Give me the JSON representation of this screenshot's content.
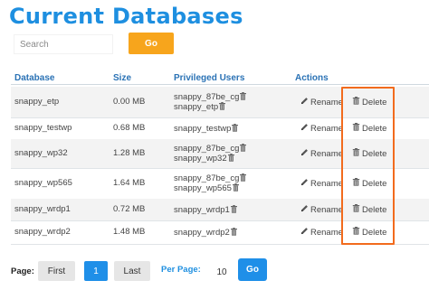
{
  "page": {
    "title": "Current Databases"
  },
  "search": {
    "placeholder": "Search",
    "value": "",
    "go_label": "Go"
  },
  "table": {
    "columns": [
      "Database",
      "Size",
      "Privileged Users",
      "Actions"
    ],
    "rename_label": "Rename",
    "delete_label": "Delete",
    "rows": [
      {
        "name": "snappy_etp",
        "size": "0.00 MB",
        "users": [
          "snappy_87be_cg",
          "snappy_etp"
        ]
      },
      {
        "name": "snappy_testwp",
        "size": "0.68 MB",
        "users": [
          "snappy_testwp"
        ]
      },
      {
        "name": "snappy_wp32",
        "size": "1.28 MB",
        "users": [
          "snappy_87be_cg",
          "snappy_wp32"
        ]
      },
      {
        "name": "snappy_wp565",
        "size": "1.64 MB",
        "users": [
          "snappy_87be_cg",
          "snappy_wp565"
        ]
      },
      {
        "name": "snappy_wrdp1",
        "size": "0.72 MB",
        "users": [
          "snappy_wrdp1"
        ]
      },
      {
        "name": "snappy_wrdp2",
        "size": "1.48 MB",
        "users": [
          "snappy_wrdp2"
        ]
      }
    ]
  },
  "pagination": {
    "page_label": "Page:",
    "first_label": "First",
    "current_page": "1",
    "last_label": "Last",
    "per_page_label": "Per Page:",
    "per_page_value": "10",
    "go_label": "Go"
  },
  "colors": {
    "accent": "#1e8fe0",
    "go_orange": "#f7a51c",
    "highlight": "#f26b1d"
  }
}
